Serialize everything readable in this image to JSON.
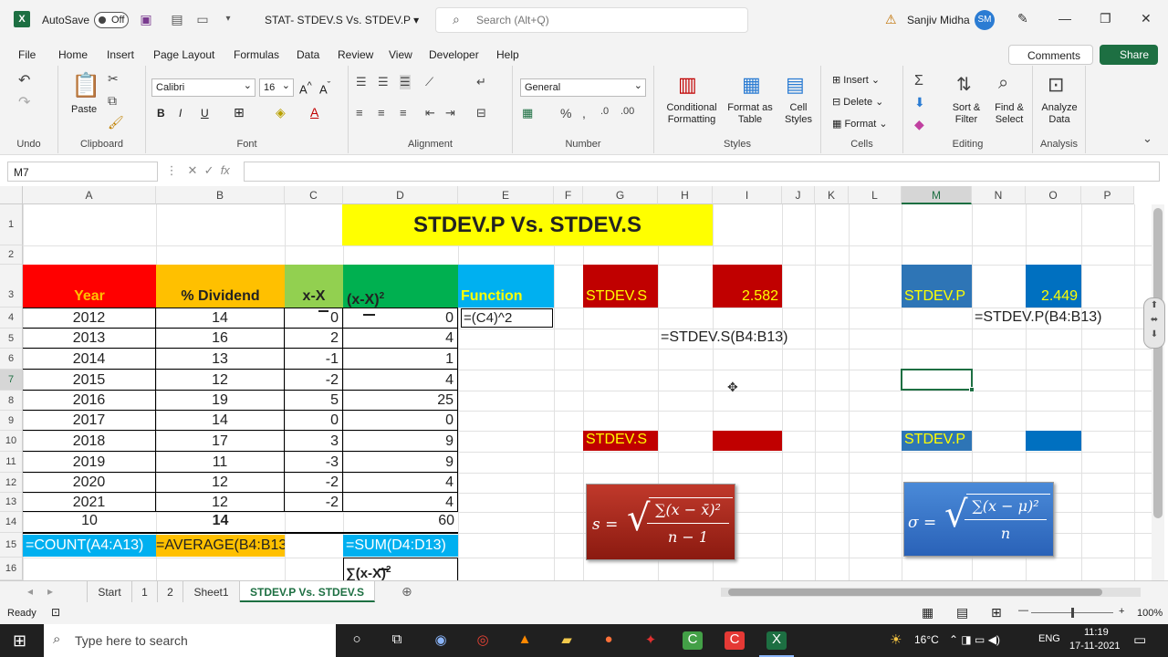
{
  "titlebar": {
    "autosave_label": "AutoSave",
    "autosave_state": "Off",
    "doc_title": "STAT- STDEV.S Vs. STDEV.P",
    "search_placeholder": "Search (Alt+Q)",
    "user_name": "Sanjiv Midha",
    "user_initials": "SM"
  },
  "menu": [
    "File",
    "Home",
    "Insert",
    "Page Layout",
    "Formulas",
    "Data",
    "Review",
    "View",
    "Developer",
    "Help"
  ],
  "comments_label": "Comments",
  "share_label": "Share",
  "ribbon": {
    "undo_label": "Undo",
    "paste_label": "Paste",
    "clipboard_label": "Clipboard",
    "font_name": "Calibri",
    "font_size": "16",
    "font_label": "Font",
    "alignment_label": "Alignment",
    "number_format": "General",
    "number_label": "Number",
    "cond_format": "Conditional Formatting",
    "format_table": "Format as Table",
    "cell_styles": "Cell Styles",
    "styles_label": "Styles",
    "insert": "Insert",
    "delete": "Delete",
    "format": "Format",
    "cells_label": "Cells",
    "sort_filter": "Sort & Filter",
    "find_select": "Find & Select",
    "editing_label": "Editing",
    "analyze_data": "Analyze Data",
    "analysis_label": "Analysis"
  },
  "formula_bar": {
    "name_box": "M7",
    "fx": "fx",
    "formula": ""
  },
  "columns": [
    "A",
    "B",
    "C",
    "D",
    "E",
    "F",
    "G",
    "H",
    "I",
    "J",
    "K",
    "L",
    "M",
    "N",
    "O",
    "P"
  ],
  "rows": [
    "1",
    "2",
    "3",
    "4",
    "5",
    "6",
    "7",
    "8",
    "9",
    "10",
    "11",
    "12",
    "13",
    "14",
    "15",
    "16"
  ],
  "sheet": {
    "title": "STDEV.P    Vs.    STDEV.S",
    "headers": {
      "year": "Year",
      "dividend": "% Dividend",
      "dev": "x-X",
      "dev_sq": "(x-X)",
      "dev_sq_exp": "2",
      "function": "Function"
    },
    "data_rows": [
      {
        "year": "2012",
        "div": "14",
        "dev": "0",
        "sq": "0"
      },
      {
        "year": "2013",
        "div": "16",
        "dev": "2",
        "sq": "4"
      },
      {
        "year": "2014",
        "div": "13",
        "dev": "-1",
        "sq": "1"
      },
      {
        "year": "2015",
        "div": "12",
        "dev": "-2",
        "sq": "4"
      },
      {
        "year": "2016",
        "div": "19",
        "dev": "5",
        "sq": "25"
      },
      {
        "year": "2017",
        "div": "14",
        "dev": "0",
        "sq": "0"
      },
      {
        "year": "2018",
        "div": "17",
        "dev": "3",
        "sq": "9"
      },
      {
        "year": "2019",
        "div": "11",
        "dev": "-3",
        "sq": "9"
      },
      {
        "year": "2020",
        "div": "12",
        "dev": "-2",
        "sq": "4"
      },
      {
        "year": "2021",
        "div": "12",
        "dev": "-2",
        "sq": "4"
      }
    ],
    "totals": {
      "count": "10",
      "avg": "14",
      "sum": "60"
    },
    "formulas": {
      "count": "=COUNT(A4:A13)",
      "avg": "=AVERAGE(B4:B13)",
      "sum": "=SUM(D4:D13)",
      "sum_label": "∑(x-X)",
      "sum_label_exp": "2",
      "e4": "=(C4)^2"
    },
    "stdev_s_label": "STDEV.S",
    "stdev_s_value": "2.582",
    "stdev_s_formula": "=STDEV.S(B4:B13)",
    "stdev_p_label": "STDEV.P",
    "stdev_p_value": "2.449",
    "stdev_p_formula": "=STDEV.P(B4:B13)",
    "stdev_s_label2": "STDEV.S",
    "stdev_p_label2": "STDEV.P"
  },
  "formula_images": {
    "sample": {
      "lhs": "s =",
      "num": "∑(x − x̄)²",
      "den": "n − 1"
    },
    "population": {
      "lhs": "σ =",
      "num": "∑(x − μ)²",
      "den": "n"
    }
  },
  "tabs": [
    "Start",
    "1",
    "2",
    "Sheet1",
    "STDEV.P Vs. STDEV.S"
  ],
  "status": {
    "ready": "Ready",
    "zoom": "100%"
  },
  "taskbar": {
    "search_placeholder": "Type here to search",
    "temp": "16°C",
    "lang": "ENG",
    "time": "11:19",
    "date": "17-11-2021"
  },
  "colors": {
    "excel_green": "#1d6f42",
    "red": "#ff0000",
    "orange": "#ffc000",
    "light_green": "#92d050",
    "green": "#00b050",
    "blue_cell": "#0070c0",
    "dark_red": "#c00000",
    "yellow": "#ffff00",
    "cyan": "#00b0f0"
  }
}
